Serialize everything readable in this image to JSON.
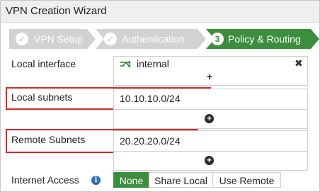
{
  "window": {
    "title": "VPN Creation Wizard"
  },
  "wizard": {
    "steps": [
      {
        "label": "VPN Setup",
        "icon": "check-icon",
        "state": "done"
      },
      {
        "label": "Authentication",
        "icon": "check-icon",
        "state": "done"
      },
      {
        "label": "Policy & Routing",
        "number": "3",
        "state": "active"
      }
    ]
  },
  "form": {
    "local_interface": {
      "label": "Local interface",
      "value": "internal",
      "icon": "interface-icon",
      "add_symbol": "+",
      "remove_symbol": "✖"
    },
    "local_subnets": {
      "label": "Local subnets",
      "value": "10.10.10.0/24",
      "add_symbol": "+"
    },
    "remote_subnets": {
      "label": "Remote Subnets",
      "value": "20.20.20.0/24",
      "add_symbol": "+"
    },
    "internet_access": {
      "label": "Internet Access",
      "info_symbol": "i",
      "options": [
        "None",
        "Share Local",
        "Use Remote"
      ],
      "selected": "None"
    }
  },
  "colors": {
    "accent": "#3d8d3f",
    "highlight": "#d22b2b",
    "step_done": "#d2d2d2"
  }
}
